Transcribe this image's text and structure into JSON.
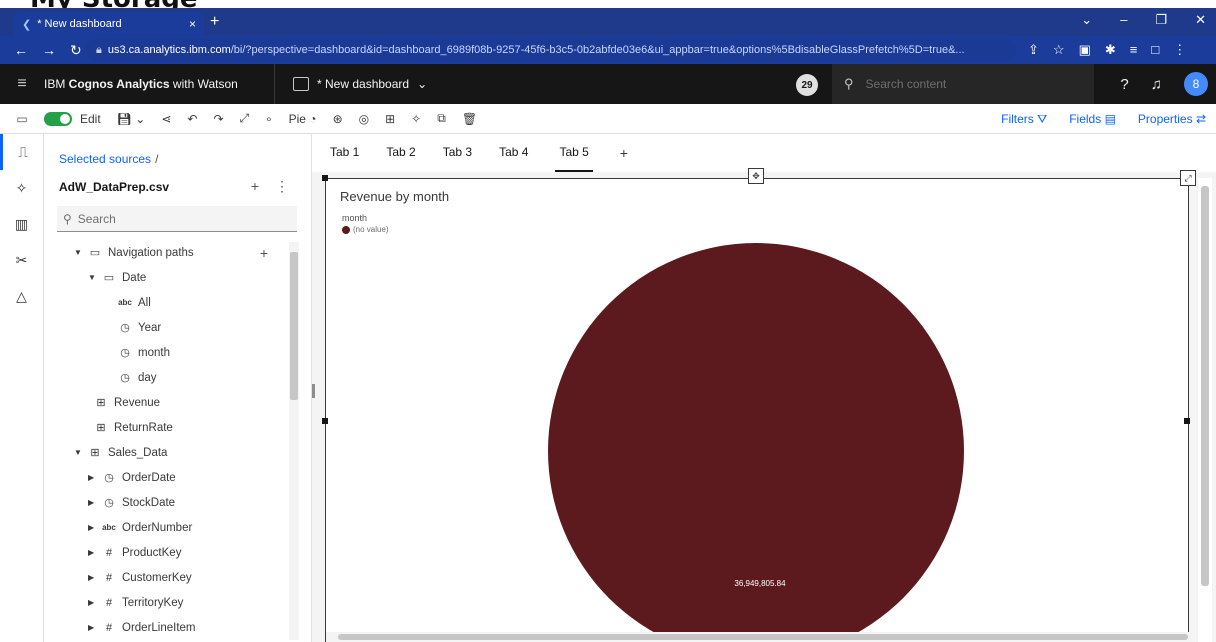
{
  "top_strip_text": "My Storage",
  "browser": {
    "tab_title": "* New dashboard",
    "tab_close": "×",
    "new_tab": "+",
    "url_host": "us3.ca.analytics.ibm.com",
    "url_rest": "/bi/?perspective=dashboard&id=dashboard_6989f08b-9257-45f6-b3c5-0b2abfde03e6&ui_appbar=true&options%5BdisableGlassPrefetch%5D=true&..."
  },
  "app_header": {
    "brand_prefix": "IBM ",
    "brand_bold": "Cognos Analytics",
    "brand_suffix": " with Watson",
    "dashboard_name": "* New dashboard",
    "notification_count": "29",
    "search_placeholder": "Search content",
    "user_initial": "8"
  },
  "toolbar": {
    "edit_label": "Edit",
    "pie_label": "Pie",
    "filters_label": "Filters",
    "fields_label": "Fields",
    "properties_label": "Properties"
  },
  "data_panel": {
    "breadcrumb": "Selected sources",
    "source_name": "AdW_DataPrep.csv",
    "search_placeholder": "Search",
    "tree": [
      {
        "label": "Navigation paths",
        "icon": "folder-icon",
        "arrow": "down",
        "plus": true
      },
      {
        "label": "Date",
        "icon": "folder-icon",
        "arrow": "down"
      },
      {
        "label": "All",
        "icon": "abc-icon"
      },
      {
        "label": "Year",
        "icon": "clock-icon"
      },
      {
        "label": "month",
        "icon": "clock-icon"
      },
      {
        "label": "day",
        "icon": "clock-icon"
      },
      {
        "label": "Revenue",
        "icon": "table-icon"
      },
      {
        "label": "ReturnRate",
        "icon": "table-icon"
      },
      {
        "label": "Sales_Data",
        "icon": "table-icon",
        "arrow": "down"
      },
      {
        "label": "OrderDate",
        "icon": "clock-icon",
        "arrow": "right"
      },
      {
        "label": "StockDate",
        "icon": "clock-icon",
        "arrow": "right"
      },
      {
        "label": "OrderNumber",
        "icon": "abc-icon",
        "arrow": "right"
      },
      {
        "label": "ProductKey",
        "icon": "hash-icon",
        "arrow": "right"
      },
      {
        "label": "CustomerKey",
        "icon": "hash-icon",
        "arrow": "right"
      },
      {
        "label": "TerritoryKey",
        "icon": "hash-icon",
        "arrow": "right"
      },
      {
        "label": "OrderLineItem",
        "icon": "hash-icon",
        "arrow": "right"
      }
    ]
  },
  "canvas": {
    "tabs": [
      "Tab 1",
      "Tab 2",
      "Tab 3",
      "Tab 4",
      "Tab 5"
    ],
    "active_tab": "Tab 5",
    "add_tab": "+"
  },
  "widget": {
    "title": "Revenue by month",
    "legend_title": "month",
    "legend_item": "(no value)"
  },
  "chart_data": {
    "type": "pie",
    "title": "Revenue by month",
    "legend_title": "month",
    "slices": [
      {
        "label": "(no value)",
        "value": 36949805.84,
        "value_label": "36,949,805.84",
        "color": "#5c1a1f"
      }
    ]
  },
  "colors": {
    "accent": "#0f62fe",
    "pie": "#5c1a1f",
    "header_bg": "#161616"
  }
}
